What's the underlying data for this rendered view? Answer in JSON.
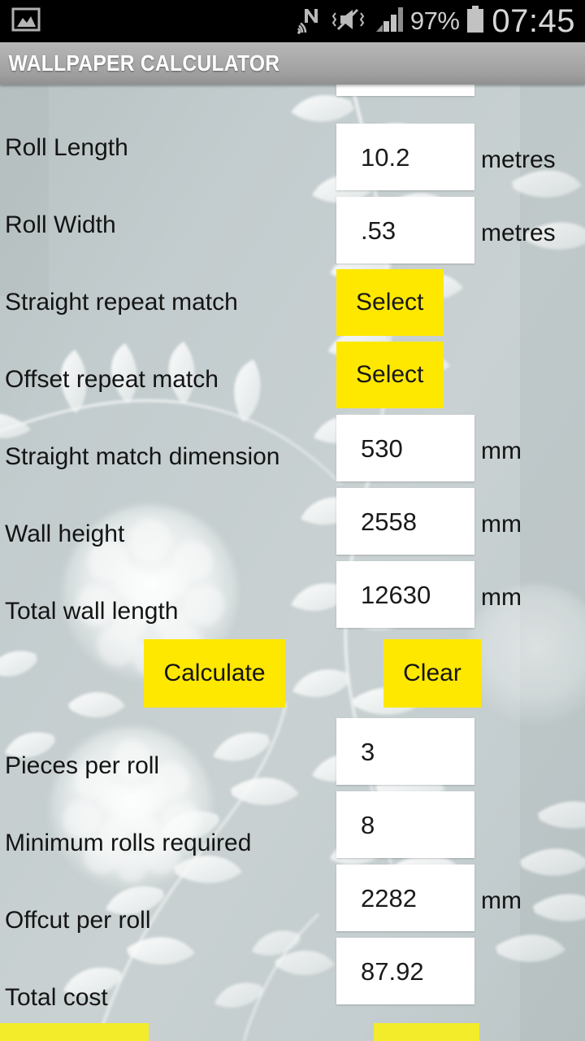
{
  "status_bar": {
    "gallery_icon": "gallery-icon",
    "nfc_icon": "nfc-icon",
    "mute_icon": "mute-vibrate-icon",
    "signal_icon": "signal-bars-icon",
    "battery_percent": "97%",
    "battery_icon": "battery-icon",
    "time": "07:45"
  },
  "action_bar": {
    "title": "WALLPAPER CALCULATOR"
  },
  "theme": {
    "accent_yellow": "#ffe800",
    "bottom_yellow": "#f2ec2a",
    "background": "#c5ced0",
    "field_bg": "#ffffff",
    "text": "#141414",
    "actionbar_text": "#ffffff"
  },
  "form": {
    "rows": [
      {
        "label": "Roll Length",
        "value": "10.2",
        "unit": "metres",
        "kind": "input"
      },
      {
        "label": "Roll Width",
        "value": ".53",
        "unit": "metres",
        "kind": "input"
      },
      {
        "label": "Straight repeat match",
        "value": "Select",
        "unit": "",
        "kind": "select"
      },
      {
        "label": "Offset repeat match",
        "value": "Select",
        "unit": "",
        "kind": "select"
      },
      {
        "label": "Straight match dimension",
        "value": "530",
        "unit": "mm",
        "kind": "input"
      },
      {
        "label": "Wall height",
        "value": "2558",
        "unit": "mm",
        "kind": "input"
      },
      {
        "label": "Total wall length",
        "value": "12630",
        "unit": "mm",
        "kind": "input"
      }
    ]
  },
  "actions": {
    "calculate_label": "Calculate",
    "clear_label": "Clear"
  },
  "results": {
    "rows": [
      {
        "label": "Pieces per roll",
        "value": "3",
        "unit": ""
      },
      {
        "label": "Minimum rolls required",
        "value": "8",
        "unit": ""
      },
      {
        "label": "Offcut per roll",
        "value": "2282",
        "unit": "mm"
      },
      {
        "label": "Total cost",
        "value": "87.92",
        "unit": ""
      }
    ]
  },
  "bottom_bar": {
    "left_button": "",
    "right_button": ""
  }
}
